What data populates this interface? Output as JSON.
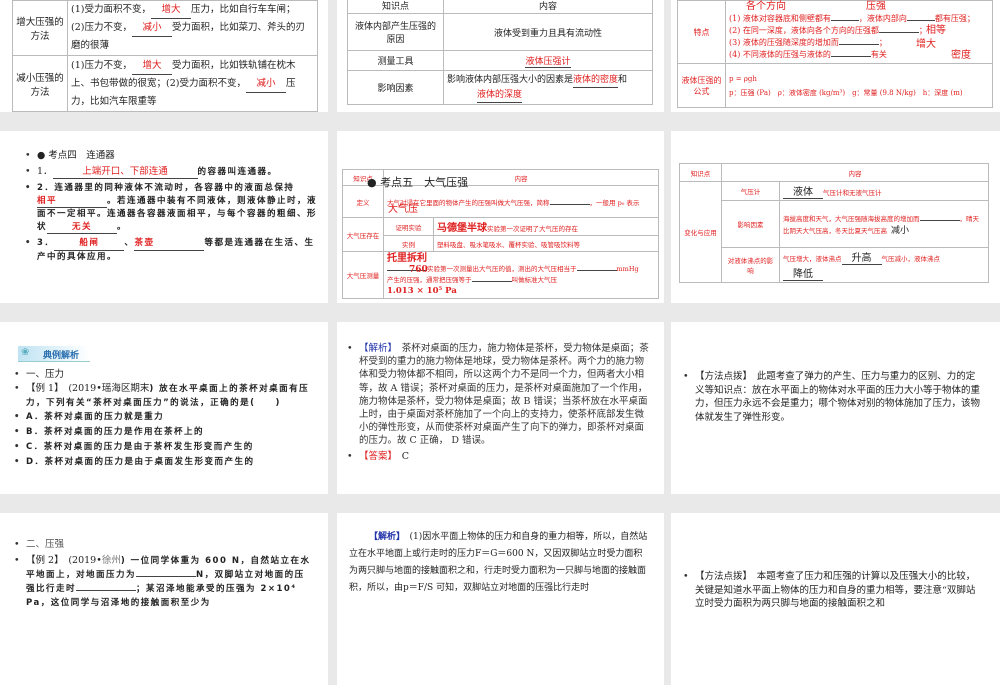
{
  "s1": {
    "r1": {
      "label": "增大压强的方法",
      "a": "(1)受力面积不变，",
      "b1": "增大",
      "c": "压力，比如自行车车闸；",
      "d": "(2)压力不变，",
      "b2": "减小",
      "e": "受力面积，比如菜刀、斧头的刃磨的很薄"
    },
    "r2": {
      "label": "减小压强的方法",
      "a": "(1)压力不变，",
      "b1": "增大",
      "c": "受力面积，比如铁轨铺在枕木上、书包带做的很宽；(2)受力面积不变，",
      "b2": "减小",
      "e": "压力，比如汽车限重等"
    }
  },
  "s2": {
    "h1": "知识点",
    "h2": "内容",
    "r1": {
      "k": "液体内部产生压强的原因",
      "v": "液体受到重力且具有流动性"
    },
    "r2": {
      "k": "测量工具",
      "v": "液体压强计"
    },
    "r3": {
      "k": "影响因素",
      "a": "影响液体内部压强大小的因素是",
      "b1": "液体的密度",
      "c": "和",
      "b2": "液体的深度"
    }
  },
  "s3": {
    "r1": {
      "k": "特点",
      "l1a": "(1) 液体对容器底和侧壁都有",
      "l1b": "，液体内部向",
      "l1c": "都有压强；",
      "l2": "(2) 在同一深度，液体向各个方向的压强都",
      "l3": "(3) 液体的压强随深度的增加而",
      "l4a": "(4) 不同液体的压强与液体的",
      "l4b": "有关",
      "ans1": "压强",
      "ans2": "各个方向",
      "ans3": "相等",
      "ans4": "增大",
      "ans5": "密度"
    },
    "r2": {
      "k": "液体压强的公式",
      "f": "p = ρgh",
      "d": "p：压强 (Pa)　ρ：液体密度 (kg/m³)　g：常量 (9.8 N/kg)　h：深度 (m)"
    }
  },
  "s4": {
    "title": "● 考点四　连通器",
    "i1a": "1．",
    "i1b": "上端开口、下部连通",
    "i1c": "的容器叫连通器。",
    "i2a": "2．连通器里的同种液体不流动时，各容器中的液面总保持",
    "i2b": "相平",
    "i2c": "。若连通器中装有不同液体，则液体静止时，液面不一定相平。连通器各容器液面相平，与每个容器的粗细、形状",
    "i2d": "无关",
    "i2e": "。",
    "i3a": "3．",
    "i3b": "船闸",
    "i3c": "、",
    "i3d": "茶壶",
    "i3e": "等都是连通器在生活、生产中的具体应用。"
  },
  "s5": {
    "title": "● 考点五　大气压强",
    "h1": "知识点",
    "h2": "内容",
    "def_k": "定义",
    "def_v": "大气对浸在它里面的物体产生的压强叫做大气压强，简称",
    "def_v2": "，一般用 p₀ 表示",
    "def_a": "大气压",
    "ex_k": "大气压存在",
    "ex1_k": "证明实验",
    "ex1_a": "马德堡半球",
    "ex1_v": "实验第一次证明了大气压的存在",
    "ex2_k": "实例",
    "ex2_v": "塑料吸盘、吸水笔吸水、覆杯实验、吸管吸饮料等",
    "m_k": "大气压测量",
    "m_a": "托里拆利",
    "m_v": "实验第一次测量出大气压的值，测出的大气压相当于",
    "m_b": "760",
    "m_u": "mmHg",
    "m_v2": "产生的压强，通常把压强等于",
    "m_v3": "叫做标准大气压",
    "m_c": "1.013 × 10⁵ Pa"
  },
  "s6": {
    "h1": "知识点",
    "h2": "内容",
    "k": "变化与应用",
    "r1k": "气压计",
    "r1a": "液体",
    "r1v": "气压计和无液气压计",
    "r2k": "影响因素",
    "r2v": "海拔高度和天气，大气压强随海拔高度的增加而",
    "r2a": "减小",
    "r2v2": "，晴天比阴天大气压高，冬天比夏天气压高",
    "r3k": "对液体沸点的影响",
    "r3v": "气压增大，液体沸点",
    "r3a": "升高",
    "r3v2": "气压减小，液体沸点",
    "r3b": "降低"
  },
  "s7": {
    "banner": "典例解析",
    "l1": "一、压力",
    "l2a": "【例 1】　(2019•",
    "l2b": "瑶海区期末",
    "l2c": ") 放在水平桌面上的茶杯对桌面有压力，下列有关“茶杯对桌面压力”的说法，正确的是(　　)",
    "a": "A．茶杯对桌面的压力就是重力",
    "b": "B．茶杯对桌面的压力是作用在茶杯上的",
    "c": "C．茶杯对桌面的压力是由于茶杯发生形变而产生的",
    "d": "D．茶杯对桌面的压力是由于桌面发生形变而产生的"
  },
  "s8": {
    "tag": "【解析】",
    "body": "茶杯对桌面的压力，施力物体是茶杯，受力物体是桌面；茶杯受到的重力的施力物体是地球，受力物体是茶杯。两个力的施力物体和受力物体都不相同，所以这两个力不是同一个力，但两者大小相等，故 A 错误；茶杯对桌面的压力，是茶杯对桌面施加了一个作用，施力物体是茶杯，受力物体是桌面；故 B 错误；当茶杯放在水平桌面上时，由于桌面对茶杯施加了一个向上的支持力，使茶杯底部发生微小的弹性形变，从而使茶杯对桌面产生了向下的弹力，即茶杯对桌面的压力。故 C 正确， D 错误。",
    "ans_tag": "【答案】",
    "ans": "C"
  },
  "s9": {
    "tag": "【方法点拨】",
    "body": "此题考查了弹力的产生、压力与重力的区别、力的定义等知识点：放在水平面上的物体对水平面的压力大小等于物体的重力，但压力永远不会是重力；哪个物体对别的物体施加了压力，该物体就发生了弹性形变。"
  },
  "s10": {
    "l1": "二、压强",
    "l2a": "【例 2】　(2019•",
    "l2b": "徐州",
    "l2c": ") 一位同学体重为 600 N，自然站立在水平地面上，对地面压力为",
    "l2d": "N，双脚站立对地面的压强比行走时",
    "l2e": "；某沼泽地能承受的压强为 2×10⁴ Pa，这位同学与沼泽地的接触面积至少为"
  },
  "s11": {
    "tag": "【解析】",
    "body": "(1)因水平面上物体的压力和自身的重力相等，所以，自然站立在水平地面上或行走时的压力F＝G＝600 N，又因双脚站立时受力面积为两只脚与地面的接触面积之和，行走时受力面积为一只脚与地面的接触面积，所以，由p＝F/S 可知，双脚站立对地面的压强比行走时"
  },
  "s12": {
    "tag": "【方法点拨】",
    "body": "本题考查了压力和压强的计算以及压强大小的比较，关键是知道水平面上物体的压力和自身的重力相等，要注意“双脚站立时受力面积为两只脚与地面的接触面积之和"
  }
}
